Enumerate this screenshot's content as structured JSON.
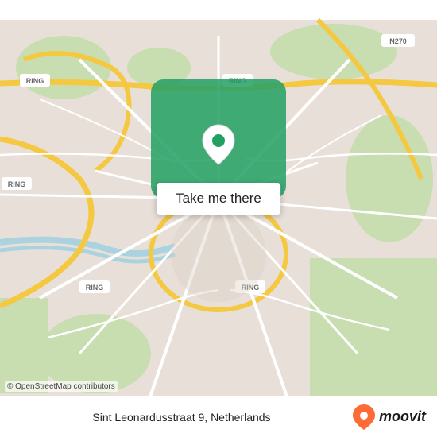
{
  "map": {
    "center_lat": 51.441,
    "center_lng": 5.478,
    "address": "Sint Leonardusstraat 9, Netherlands",
    "button_label": "Take me there",
    "attribution": "© OpenStreetMap contributors",
    "moovit_label": "moovit"
  },
  "colors": {
    "map_bg": "#e8e0d8",
    "road_major": "#f5c842",
    "road_minor": "#ffffff",
    "green_area": "#c8ddb0",
    "water": "#aad3df",
    "green_overlay": "#22a064",
    "ring_label": "#d4ac1a"
  },
  "ring_labels": [
    "RING",
    "RING",
    "RING",
    "RING",
    "RING",
    "RING",
    "N270"
  ],
  "moovit_icon_color": "#ff6b35"
}
